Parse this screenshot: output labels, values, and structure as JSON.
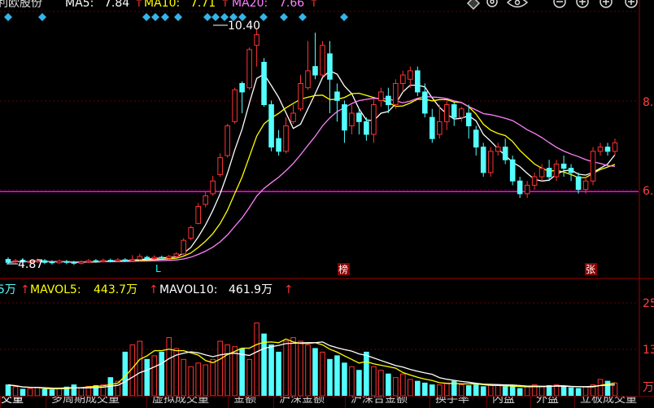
{
  "header": {
    "stock_name": "利欧股份",
    "ma5_label": "MA5:",
    "ma5_value": "7.84",
    "ma10_label": "MA10:",
    "ma10_value": "7.71",
    "ma20_label": "MA20:",
    "ma20_value": "7.66",
    "up_arrow": "↑"
  },
  "price_axis": {
    "labels": [
      "8.",
      "6."
    ]
  },
  "markers": {
    "high_label": "10.40",
    "low_label": "4.87",
    "tag_l": "L",
    "tag_bang": "榜",
    "tag_zhang": "张"
  },
  "volume_header": {
    "prefix": "5万",
    "mavol5_label": "MAVOL5:",
    "mavol5_value": "443.7万",
    "mavol10_label": "MAVOL10:",
    "mavol10_value": "461.9万"
  },
  "volume_axis": {
    "labels": [
      "25",
      "13",
      "万"
    ]
  },
  "toolbar": {
    "icons": [
      "diamond-icon",
      "settings-icon",
      "eye-icon",
      "minus-circle-icon",
      "plus-circle-icon",
      "plus-circle-icon"
    ]
  },
  "tabs": [
    "成交量",
    "多周期成交量",
    "虚拟成交量",
    "金额",
    "沪深金额",
    "沪深合金额",
    "换手率",
    "内盘",
    "外盘",
    "立板成交量"
  ],
  "colors": {
    "up": "#ff3232",
    "down": "#54ffff",
    "ma5": "#ffffff",
    "ma10": "#ffff00",
    "ma20": "#ff80ff",
    "support": "#ff00ff"
  },
  "chart_data": {
    "type": "candlestick",
    "price_ylim": [
      4.5,
      10.8
    ],
    "support_line": 6.55,
    "candles": [
      [
        4.95,
        4.88,
        5.0,
        4.85
      ],
      [
        4.9,
        4.92,
        4.96,
        4.86
      ],
      [
        4.93,
        4.89,
        4.98,
        4.86
      ],
      [
        4.88,
        4.9,
        4.94,
        4.84
      ],
      [
        4.9,
        4.93,
        4.97,
        4.87
      ],
      [
        4.92,
        4.88,
        4.96,
        4.84
      ],
      [
        4.89,
        4.87,
        4.93,
        4.83
      ],
      [
        4.87,
        4.91,
        4.95,
        4.85
      ],
      [
        4.9,
        4.88,
        4.94,
        4.84
      ],
      [
        4.88,
        4.86,
        4.92,
        4.82
      ],
      [
        4.86,
        4.89,
        4.93,
        4.83
      ],
      [
        4.89,
        4.92,
        4.96,
        4.86
      ],
      [
        4.92,
        4.9,
        4.96,
        4.87
      ],
      [
        4.9,
        4.93,
        4.97,
        4.88
      ],
      [
        4.93,
        4.91,
        4.97,
        4.88
      ],
      [
        4.91,
        4.94,
        4.98,
        4.88
      ],
      [
        4.94,
        4.92,
        4.98,
        4.89
      ],
      [
        4.92,
        4.95,
        5.05,
        4.9
      ],
      [
        4.95,
        5.02,
        5.08,
        4.93
      ],
      [
        5.0,
        4.97,
        5.04,
        4.93
      ],
      [
        4.97,
        5.0,
        5.05,
        4.94
      ],
      [
        5.0,
        4.98,
        5.04,
        4.95
      ],
      [
        4.98,
        5.02,
        5.06,
        4.96
      ],
      [
        5.02,
        5.08,
        5.12,
        5.0
      ],
      [
        5.08,
        5.4,
        5.45,
        5.05
      ],
      [
        5.45,
        5.7,
        5.75,
        5.4
      ],
      [
        5.8,
        6.2,
        6.28,
        5.78
      ],
      [
        6.25,
        6.45,
        6.55,
        6.18
      ],
      [
        6.5,
        6.8,
        6.92,
        6.45
      ],
      [
        6.95,
        7.35,
        7.45,
        6.9
      ],
      [
        7.4,
        8.1,
        8.15,
        7.35
      ],
      [
        8.2,
        8.95,
        9.0,
        8.15
      ],
      [
        9.1,
        8.9,
        9.15,
        8.4
      ],
      [
        9.0,
        9.9,
        9.95,
        8.95
      ],
      [
        10.0,
        10.25,
        10.4,
        9.5
      ],
      [
        9.6,
        8.6,
        9.7,
        8.55
      ],
      [
        8.6,
        7.6,
        8.7,
        7.5
      ],
      [
        7.8,
        7.5,
        8.0,
        7.4
      ],
      [
        7.5,
        8.1,
        8.3,
        7.45
      ],
      [
        8.2,
        8.4,
        8.6,
        8.15
      ],
      [
        8.5,
        9.1,
        9.3,
        8.45
      ],
      [
        9.0,
        9.4,
        10.1,
        8.95
      ],
      [
        9.5,
        9.3,
        10.3,
        9.2
      ],
      [
        9.3,
        10.0,
        10.1,
        9.25
      ],
      [
        9.8,
        9.2,
        10.1,
        8.4
      ],
      [
        8.9,
        8.7,
        9.1,
        8.2
      ],
      [
        8.6,
        8.0,
        8.7,
        7.7
      ],
      [
        8.1,
        8.4,
        8.6,
        7.9
      ],
      [
        8.4,
        8.2,
        8.5,
        7.9
      ],
      [
        8.2,
        7.9,
        8.3,
        7.75
      ],
      [
        7.9,
        8.6,
        8.75,
        7.7
      ],
      [
        8.7,
        8.9,
        9.0,
        8.55
      ],
      [
        8.8,
        8.6,
        9.0,
        8.4
      ],
      [
        8.6,
        9.1,
        9.2,
        8.5
      ],
      [
        9.1,
        9.3,
        9.4,
        8.9
      ],
      [
        9.2,
        9.4,
        9.5,
        9.0
      ],
      [
        9.4,
        8.9,
        9.5,
        8.8
      ],
      [
        8.9,
        8.4,
        9.1,
        8.3
      ],
      [
        8.3,
        7.8,
        8.5,
        7.7
      ],
      [
        7.9,
        8.2,
        8.6,
        7.8
      ],
      [
        8.2,
        8.6,
        8.7,
        8.0
      ],
      [
        8.6,
        8.3,
        8.65,
        8.1
      ],
      [
        8.3,
        8.5,
        8.55,
        8.2
      ],
      [
        8.4,
        8.1,
        8.6,
        7.8
      ],
      [
        8.0,
        7.6,
        8.1,
        7.4
      ],
      [
        7.6,
        7.0,
        7.7,
        6.9
      ],
      [
        7.0,
        7.5,
        7.6,
        6.9
      ],
      [
        7.5,
        7.6,
        7.7,
        7.4
      ],
      [
        7.6,
        7.3,
        7.8,
        7.2
      ],
      [
        7.3,
        6.8,
        7.4,
        6.7
      ],
      [
        6.8,
        6.5,
        6.9,
        6.4
      ],
      [
        6.5,
        6.7,
        6.8,
        6.4
      ],
      [
        6.7,
        6.9,
        7.0,
        6.6
      ],
      [
        6.9,
        7.1,
        7.2,
        6.8
      ],
      [
        7.1,
        6.9,
        7.3,
        6.8
      ],
      [
        6.9,
        7.2,
        7.3,
        6.8
      ],
      [
        7.2,
        7.1,
        7.4,
        6.9
      ],
      [
        7.1,
        7.0,
        7.2,
        6.8
      ],
      [
        6.9,
        6.6,
        7.0,
        6.5
      ],
      [
        6.6,
        6.8,
        6.9,
        6.5
      ],
      [
        6.8,
        7.5,
        7.6,
        6.7
      ],
      [
        7.5,
        7.6,
        7.7,
        7.4
      ],
      [
        7.6,
        7.5,
        7.7,
        7.4
      ],
      [
        7.5,
        7.7,
        7.8,
        7.4
      ]
    ],
    "volume": [
      30,
      25,
      18,
      20,
      22,
      18,
      16,
      20,
      24,
      30,
      22,
      26,
      28,
      30,
      50,
      40,
      120,
      140,
      150,
      100,
      110,
      120,
      160,
      130,
      100,
      80,
      90,
      85,
      100,
      150,
      140,
      135,
      130,
      100,
      200,
      170,
      140,
      120,
      150,
      160,
      150,
      140,
      130,
      120,
      100,
      110,
      90,
      80,
      70,
      120,
      80,
      70,
      60,
      50,
      60,
      45,
      40,
      35,
      30,
      30,
      35,
      40,
      30,
      28,
      30,
      25,
      30,
      28,
      25,
      25,
      20,
      25,
      30,
      25,
      28,
      30,
      25,
      22,
      20,
      25,
      30,
      45,
      40,
      35
    ],
    "volume_ylim": [
      0,
      300
    ]
  }
}
